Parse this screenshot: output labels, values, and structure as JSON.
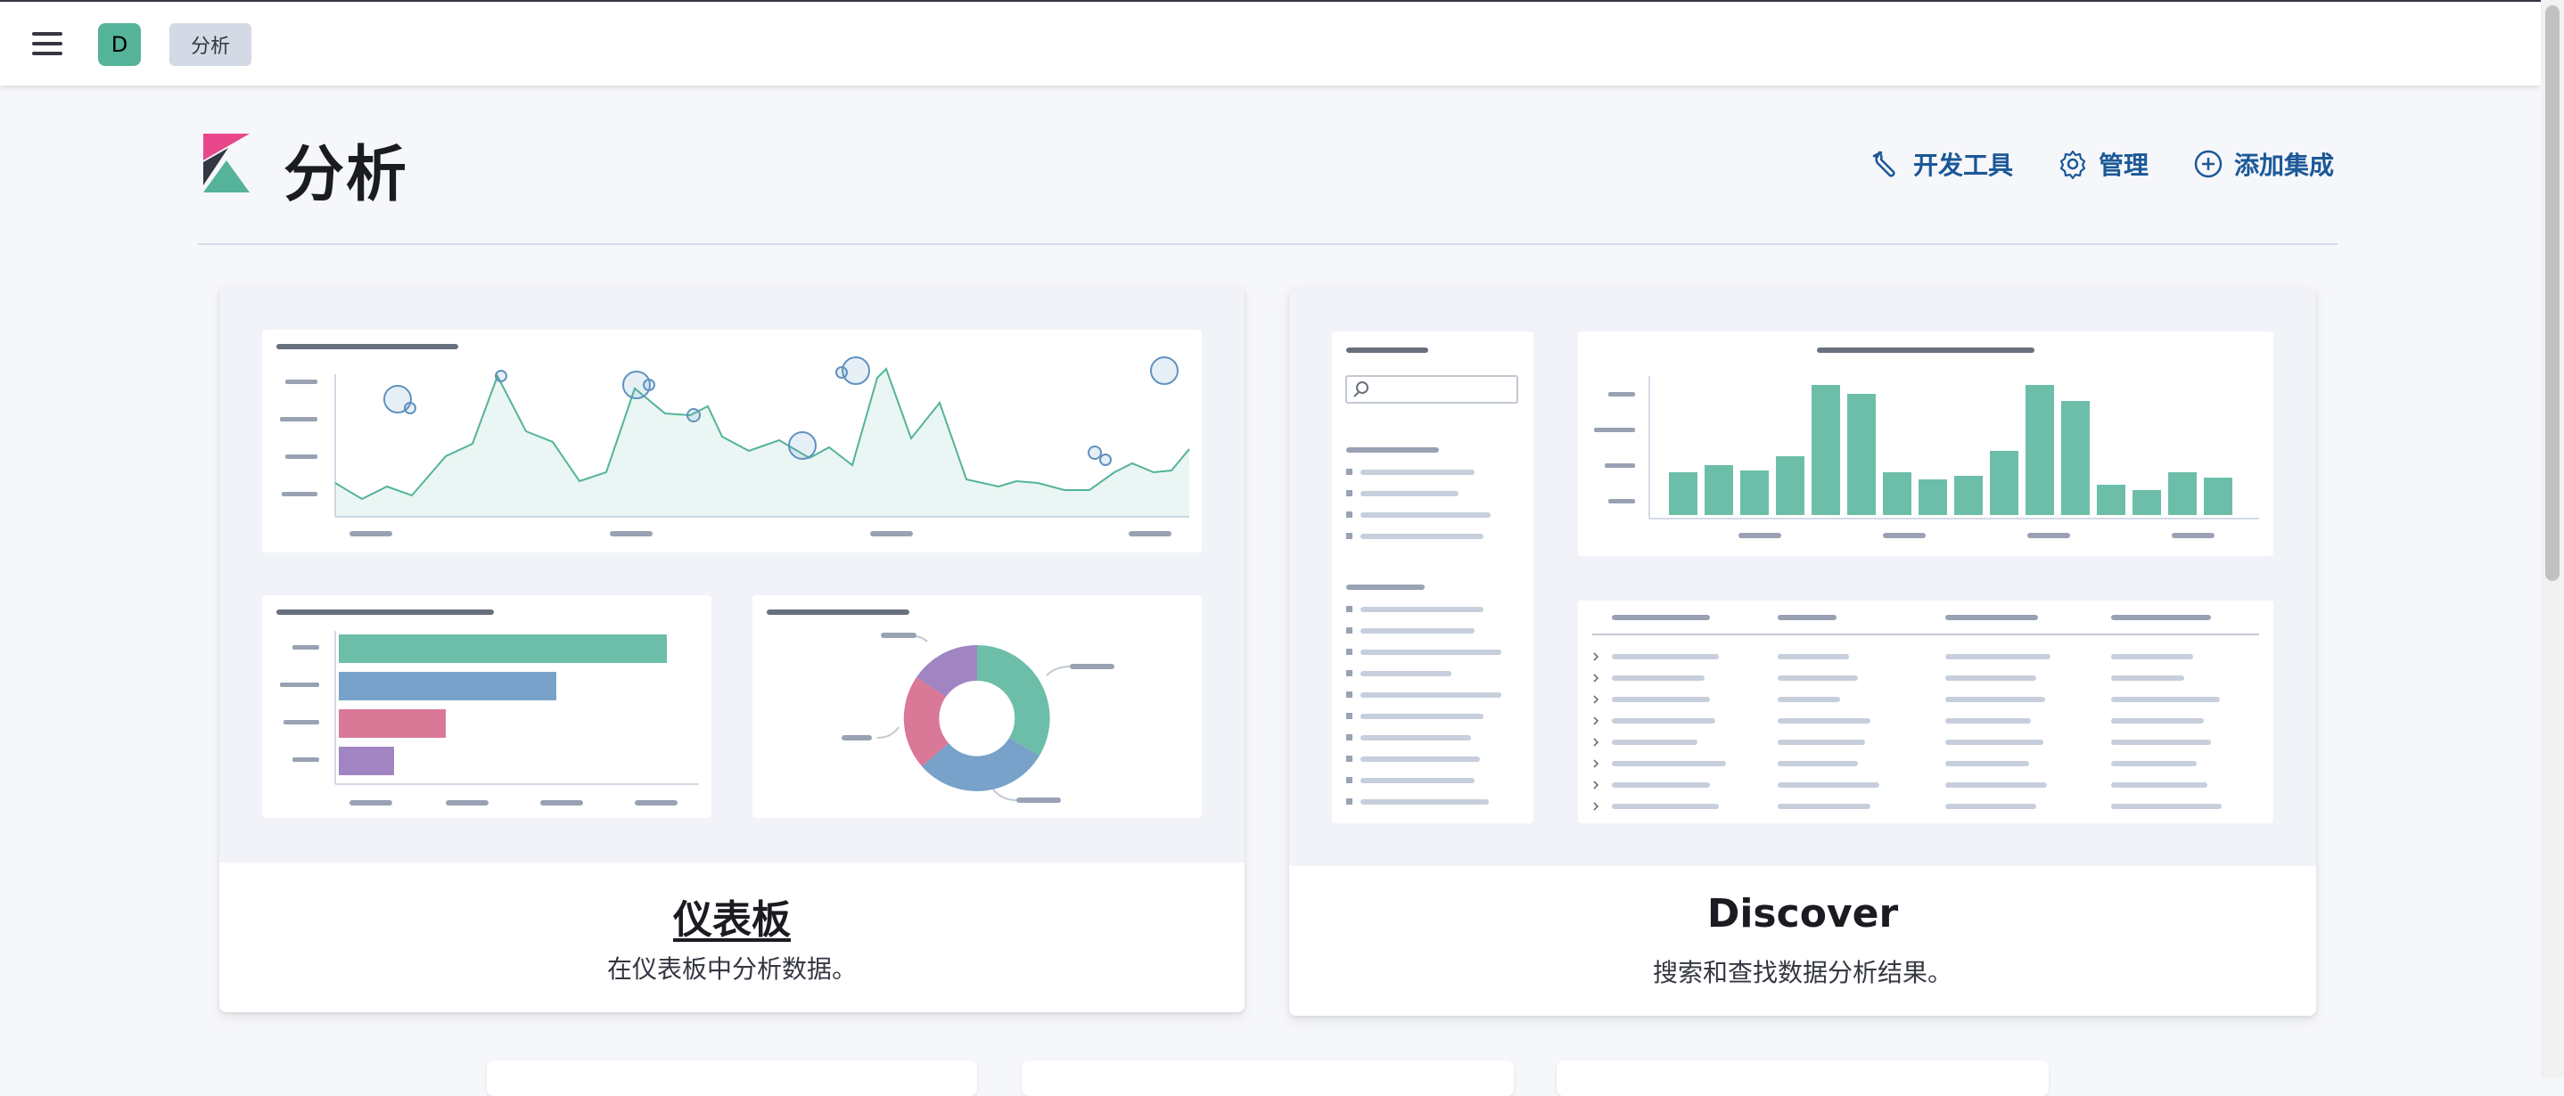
{
  "header": {
    "avatar_letter": "D",
    "breadcrumb": "分析",
    "page_title": "分析",
    "links": [
      {
        "label": "开发工具",
        "icon": "wrench-icon"
      },
      {
        "label": "管理",
        "icon": "gear-icon"
      },
      {
        "label": "添加集成",
        "icon": "plus-circle-icon"
      }
    ]
  },
  "cards": [
    {
      "title": "仪表板",
      "description": "在仪表板中分析数据。",
      "illustration": "dashboard-illustration"
    },
    {
      "title": "Discover",
      "description": "搜索和查找数据分析结果。",
      "illustration": "discover-illustration"
    }
  ],
  "colors": {
    "accent_blue": "#1b5897",
    "teal": "#54b399",
    "blue": "#6092c0",
    "pink": "#d36086",
    "purple": "#9170b8",
    "logo_pink": "#e8478b",
    "logo_dark": "#343741"
  }
}
